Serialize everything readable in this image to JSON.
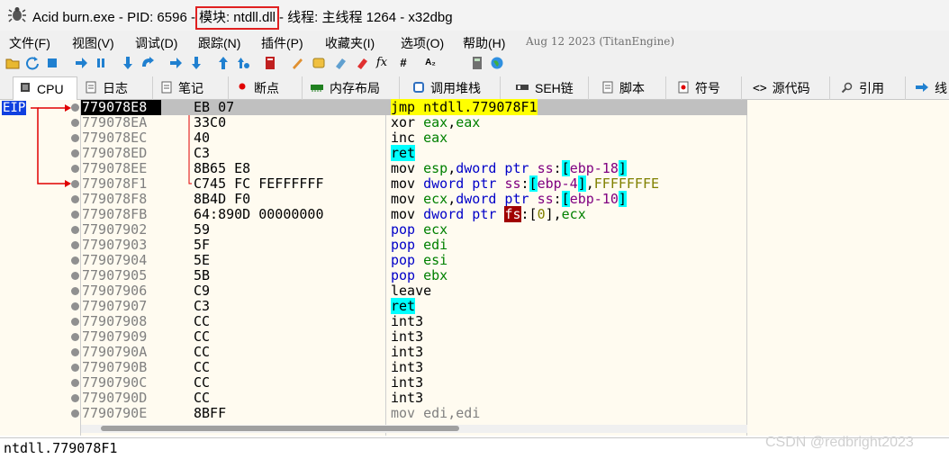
{
  "window": {
    "process_name": "Acid burn.exe",
    "pid_label": "PID: 6596",
    "module_label": "模块: ntdll.dll",
    "thread_label": "线程: 主线程 1264",
    "app_name": "x32dbg",
    "sep": "-"
  },
  "menu": {
    "items": [
      "文件(F)",
      "视图(V)",
      "调试(D)",
      "跟踪(N)",
      "插件(P)",
      "收藏夹(I)",
      "选项(O)",
      "帮助(H)"
    ],
    "build_date": "Aug 12 2023 (TitanEngine)"
  },
  "toolbar": {
    "icons": [
      "open-icon",
      "restart-icon",
      "stop-icon",
      "run-icon",
      "pause-icon",
      "step-into-icon",
      "step-over-icon",
      "trace-into-icon",
      "trace-over-icon",
      "execute-till-return-icon",
      "run-to-user-code-icon",
      "patch-icon",
      "comment-icon",
      "label-icon",
      "bookmark-icon",
      "function-icon",
      "fx-icon",
      "hash-icon",
      "strings-icon",
      "calculator-icon",
      "globe-icon"
    ],
    "fx": "fx",
    "hash": "#",
    "az": "A₂"
  },
  "tabs": [
    {
      "label": "CPU",
      "icon": "cpu-icon",
      "active": true
    },
    {
      "label": "日志",
      "icon": "log-icon"
    },
    {
      "label": "笔记",
      "icon": "notes-icon"
    },
    {
      "label": "断点",
      "icon": "breakpoint-icon"
    },
    {
      "label": "内存布局",
      "icon": "memory-map-icon"
    },
    {
      "label": "调用堆栈",
      "icon": "call-stack-icon"
    },
    {
      "label": "SEH链",
      "icon": "seh-chain-icon"
    },
    {
      "label": "脚本",
      "icon": "script-icon"
    },
    {
      "label": "符号",
      "icon": "symbols-icon"
    },
    {
      "label": "源代码",
      "icon": "source-icon"
    },
    {
      "label": "引用",
      "icon": "references-icon"
    },
    {
      "label": "线",
      "icon": "threads-icon"
    }
  ],
  "eip_label": "EIP",
  "disasm": [
    {
      "addr": "779078E8",
      "bytes": "EB 07",
      "ins": "jmp ntdll.779078F1",
      "current": true
    },
    {
      "addr": "779078EA",
      "bytes": "33C0",
      "ins": "xor eax,eax"
    },
    {
      "addr": "779078EC",
      "bytes": "40",
      "ins": "inc eax"
    },
    {
      "addr": "779078ED",
      "bytes": "C3",
      "ins": "ret"
    },
    {
      "addr": "779078EE",
      "bytes": "8B65 E8",
      "ins": "mov esp,dword ptr ss:[ebp-18]"
    },
    {
      "addr": "779078F1",
      "bytes": "C745 FC FEFFFFFF",
      "ins": "mov dword ptr ss:[ebp-4],FFFFFFFE"
    },
    {
      "addr": "779078F8",
      "bytes": "8B4D F0",
      "ins": "mov ecx,dword ptr ss:[ebp-10]"
    },
    {
      "addr": "779078FB",
      "bytes": "64:890D 00000000",
      "ins": "mov dword ptr fs:[0],ecx"
    },
    {
      "addr": "77907902",
      "bytes": "59",
      "ins": "pop ecx"
    },
    {
      "addr": "77907903",
      "bytes": "5F",
      "ins": "pop edi"
    },
    {
      "addr": "77907904",
      "bytes": "5E",
      "ins": "pop esi"
    },
    {
      "addr": "77907905",
      "bytes": "5B",
      "ins": "pop ebx"
    },
    {
      "addr": "77907906",
      "bytes": "C9",
      "ins": "leave"
    },
    {
      "addr": "77907907",
      "bytes": "C3",
      "ins": "ret"
    },
    {
      "addr": "77907908",
      "bytes": "CC",
      "ins": "int3"
    },
    {
      "addr": "77907909",
      "bytes": "CC",
      "ins": "int3"
    },
    {
      "addr": "7790790A",
      "bytes": "CC",
      "ins": "int3"
    },
    {
      "addr": "7790790B",
      "bytes": "CC",
      "ins": "int3"
    },
    {
      "addr": "7790790C",
      "bytes": "CC",
      "ins": "int3"
    },
    {
      "addr": "7790790D",
      "bytes": "CC",
      "ins": "int3"
    },
    {
      "addr": "7790790E",
      "bytes": "8BFF",
      "ins": "mov edi,edi"
    }
  ],
  "info_bar": "ntdll.779078F1",
  "watermark": "CSDN @redbright2023",
  "colors": {
    "eip_bg": "#1040e0",
    "jump_arrow": "#e00000",
    "jmp_highlight": "#ffff00",
    "ret_highlight": "#00ffff",
    "segment_highlight": "#a00000",
    "pane_bg": "#fffbf0"
  }
}
